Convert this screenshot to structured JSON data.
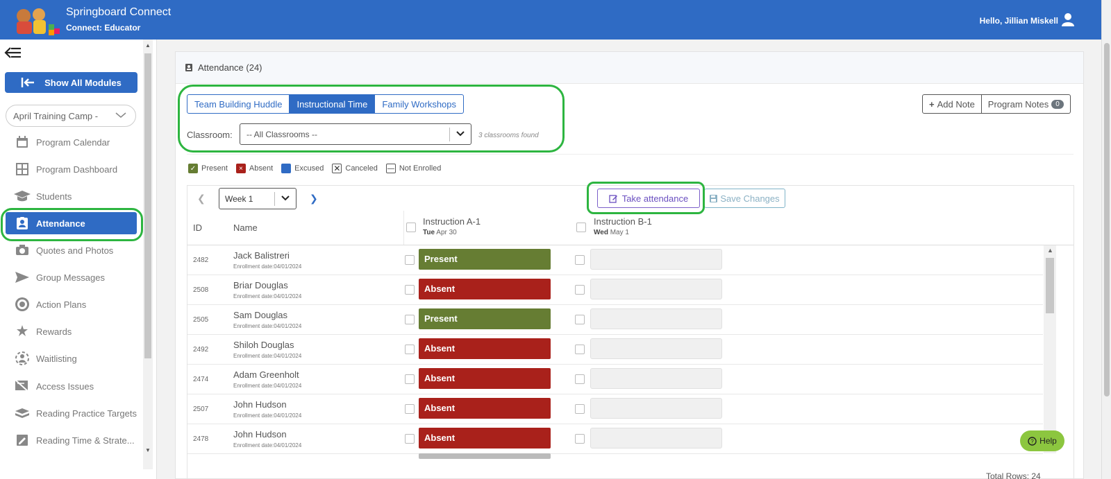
{
  "header": {
    "app_title": "Springboard Connect",
    "app_subtitle": "Connect: Educator",
    "greeting": "Hello, Jillian Miskell"
  },
  "sidebar": {
    "show_all_label": "Show All Modules",
    "program_select_value": "April Training Camp -",
    "items": [
      {
        "label": "Program Calendar",
        "icon": "calendar-icon"
      },
      {
        "label": "Program Dashboard",
        "icon": "dashboard-grid-icon"
      },
      {
        "label": "Students",
        "icon": "graduation-cap-icon"
      },
      {
        "label": "Attendance",
        "icon": "attendance-badge-icon",
        "active": true
      },
      {
        "label": "Quotes and Photos",
        "icon": "camera-icon"
      },
      {
        "label": "Group Messages",
        "icon": "send-icon"
      },
      {
        "label": "Action Plans",
        "icon": "target-icon"
      },
      {
        "label": "Rewards",
        "icon": "star-award-icon"
      },
      {
        "label": "Waitlisting",
        "icon": "waitlist-icon"
      },
      {
        "label": "Access Issues",
        "icon": "access-issues-icon"
      },
      {
        "label": "Reading Practice Targets",
        "icon": "book-icon"
      },
      {
        "label": "Reading Time & Strate...",
        "icon": "edit-square-icon"
      }
    ]
  },
  "main": {
    "card_title": "Attendance (24)",
    "tabs": [
      {
        "label": "Team Building Huddle"
      },
      {
        "label": "Instructional Time",
        "active": true
      },
      {
        "label": "Family Workshops"
      }
    ],
    "classroom_label": "Classroom:",
    "classroom_value": "-- All Classrooms --",
    "classrooms_found": "3 classrooms found",
    "add_note_label": "Add Note",
    "program_notes_label": "Program Notes",
    "program_notes_count": "0",
    "legend": [
      {
        "label": "Present",
        "color": "#667d33",
        "symbol": "✓"
      },
      {
        "label": "Absent",
        "color": "#a9211b",
        "symbol": "×"
      },
      {
        "label": "Excused",
        "color": "#2f6bc4",
        "symbol": ""
      },
      {
        "label": "Canceled",
        "color": "#ffffff",
        "symbol": "✕"
      },
      {
        "label": "Not Enrolled",
        "color": "#ffffff",
        "symbol": "—"
      }
    ],
    "week_value": "Week 1",
    "take_attendance_label": "Take attendance",
    "save_changes_label": "Save Changes",
    "columns": {
      "id": "ID",
      "name": "Name",
      "session_a": {
        "title": "Instruction A-1",
        "day": "Tue",
        "date": "Apr 30"
      },
      "session_b": {
        "title": "Instruction B-1",
        "day": "Wed",
        "date": "May 1"
      }
    },
    "rows": [
      {
        "id": "2482",
        "name": "Jack Balistreri",
        "enrollment": "Enrollment date:04/01/2024",
        "status": "Present"
      },
      {
        "id": "2508",
        "name": "Briar Douglas",
        "enrollment": "Enrollment date:04/01/2024",
        "status": "Absent"
      },
      {
        "id": "2505",
        "name": "Sam Douglas",
        "enrollment": "Enrollment date:04/01/2024",
        "status": "Present"
      },
      {
        "id": "2492",
        "name": "Shiloh Douglas",
        "enrollment": "Enrollment date:04/01/2024",
        "status": "Absent"
      },
      {
        "id": "2474",
        "name": "Adam Greenholt",
        "enrollment": "Enrollment date:04/01/2024",
        "status": "Absent"
      },
      {
        "id": "2507",
        "name": "John Hudson",
        "enrollment": "Enrollment date:04/01/2024",
        "status": "Absent"
      },
      {
        "id": "2478",
        "name": "John Hudson",
        "enrollment": "Enrollment date:04/01/2024",
        "status": "Absent"
      }
    ],
    "total_rows": "Total Rows: 24"
  },
  "help_label": "Help",
  "colors": {
    "brand": "#2f6bc4",
    "present": "#667d33",
    "absent": "#a9211b",
    "highlight": "#2db540"
  }
}
